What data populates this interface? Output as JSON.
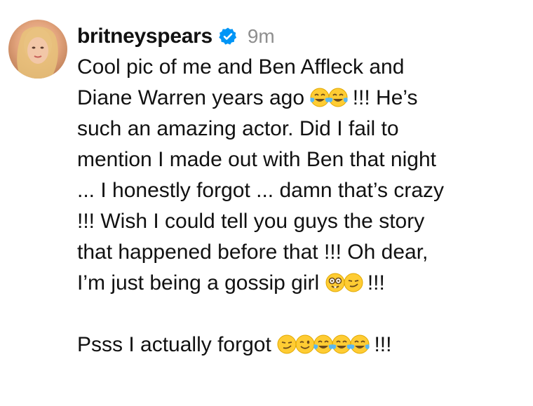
{
  "post": {
    "username": "britneyspears",
    "time": "9m",
    "verified_icon": "verified-badge-icon",
    "lines": [
      {
        "text": "Cool pic of me and Ben Affleck and"
      },
      {
        "pre": "Diane Warren years ago ",
        "emojis": [
          "face-with-tears-of-joy",
          "face-with-tears-of-joy"
        ],
        "post": " !!! He’s"
      },
      {
        "text": "such an amazing actor. Did I fail to"
      },
      {
        "text": "mention I made out with Ben that night"
      },
      {
        "text": "... I honestly forgot ... damn that’s crazy"
      },
      {
        "text": "!!! Wish I could tell you guys the story"
      },
      {
        "text": "that happened before that !!! Oh dear,"
      },
      {
        "pre": "I’m just being a gossip girl ",
        "emojis": [
          "nerd-face",
          "smirking-face"
        ],
        "post": " !!!"
      },
      {
        "pre": "Psss I actually forgot ",
        "emojis": [
          "smirking-face",
          "winking-face",
          "face-with-tears-of-joy",
          "face-with-tears-of-joy",
          "face-with-tears-of-joy"
        ],
        "post": " !!!"
      }
    ]
  },
  "colors": {
    "text": "#111111",
    "muted": "#8e8e8e",
    "verified": "#0095f6",
    "emoji_yellow": "#ffcc33"
  }
}
